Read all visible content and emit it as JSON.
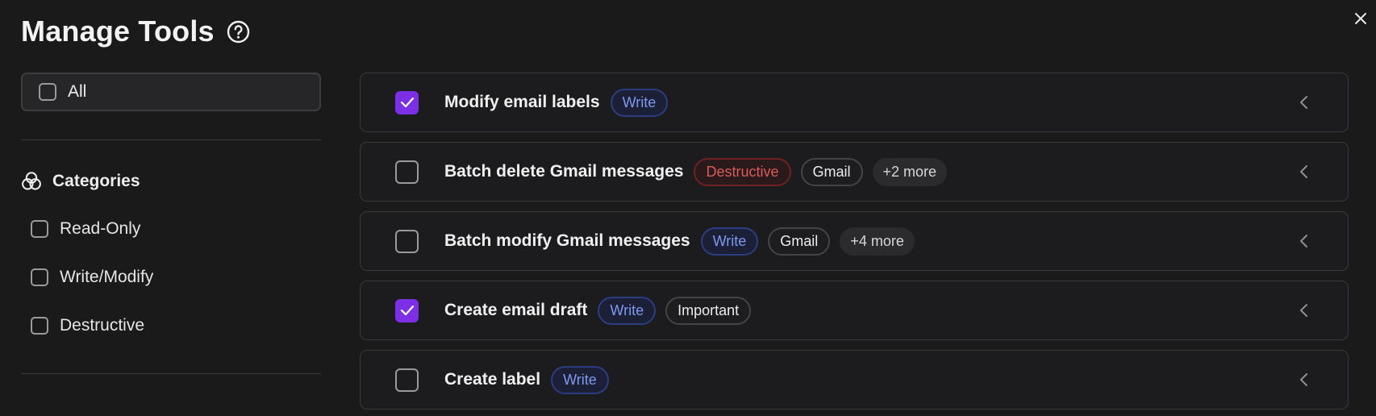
{
  "header": {
    "title": "Manage Tools"
  },
  "sidebar": {
    "all_label": "All",
    "categories_title": "Categories",
    "categories": [
      {
        "label": "Read-Only",
        "checked": false
      },
      {
        "label": "Write/Modify",
        "checked": false
      },
      {
        "label": "Destructive",
        "checked": false
      }
    ]
  },
  "tools": [
    {
      "name": "Modify email labels",
      "checked": true,
      "badges": [
        {
          "label": "Write",
          "kind": "write"
        }
      ]
    },
    {
      "name": "Batch delete Gmail messages",
      "checked": false,
      "badges": [
        {
          "label": "Destructive",
          "kind": "destructive"
        },
        {
          "label": "Gmail",
          "kind": "neutral"
        },
        {
          "label": "+2 more",
          "kind": "more"
        }
      ]
    },
    {
      "name": "Batch modify Gmail messages",
      "checked": false,
      "badges": [
        {
          "label": "Write",
          "kind": "write"
        },
        {
          "label": "Gmail",
          "kind": "neutral"
        },
        {
          "label": "+4 more",
          "kind": "more"
        }
      ]
    },
    {
      "name": "Create email draft",
      "checked": true,
      "badges": [
        {
          "label": "Write",
          "kind": "write"
        },
        {
          "label": "Important",
          "kind": "neutral"
        }
      ]
    },
    {
      "name": "Create label",
      "checked": false,
      "badges": [
        {
          "label": "Write",
          "kind": "write"
        }
      ]
    }
  ],
  "colors": {
    "background": "#1a1a1b",
    "accent_checked": "#7c2fe6",
    "write_badge": "#7f98ee",
    "destructive_badge": "#d85b5b"
  },
  "icons": {
    "close": "close-icon",
    "help": "help-circle-icon",
    "categories": "categories-circles-icon",
    "check": "check-icon",
    "row_toggle": "chevron-left-icon"
  }
}
